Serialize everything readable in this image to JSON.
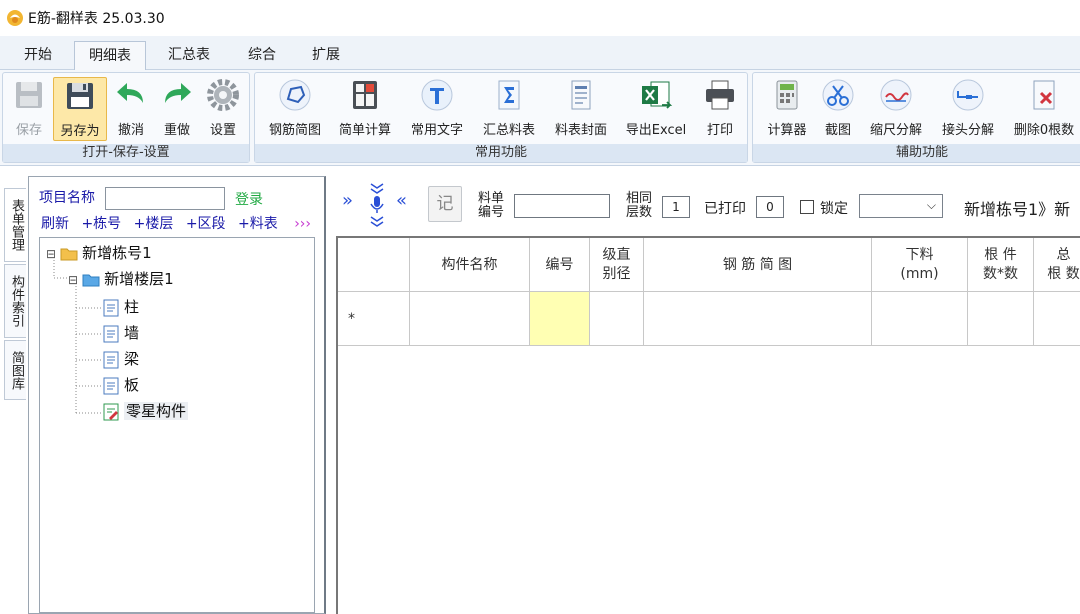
{
  "window": {
    "title": "E筋-翻样表 25.03.30"
  },
  "menu": {
    "tabs": [
      {
        "label": "开始"
      },
      {
        "label": "明细表"
      },
      {
        "label": "汇总表"
      },
      {
        "label": "综合"
      },
      {
        "label": "扩展"
      }
    ],
    "active_index": 1
  },
  "ribbon": {
    "groups": [
      {
        "label": "打开-保存-设置",
        "buttons": [
          {
            "label": "保存",
            "icon": "save-disk-icon",
            "enabled": false
          },
          {
            "label": "另存为",
            "icon": "save-as-disk-icon",
            "enabled": true,
            "pressed": true
          },
          {
            "label": "撤消",
            "icon": "undo-arrow-icon",
            "enabled": true
          },
          {
            "label": "重做",
            "icon": "redo-arrow-icon",
            "enabled": true
          },
          {
            "label": "设置",
            "icon": "gear-icon",
            "enabled": true
          }
        ]
      },
      {
        "label": "常用功能",
        "buttons": [
          {
            "label": "钢筋简图",
            "icon": "rebar-shape-icon"
          },
          {
            "label": "简单计算",
            "icon": "calculator-icon"
          },
          {
            "label": "常用文字",
            "icon": "text-t-icon"
          },
          {
            "label": "汇总料表",
            "icon": "sigma-sheet-icon"
          },
          {
            "label": "料表封面",
            "icon": "document-cover-icon"
          },
          {
            "label": "导出Excel",
            "icon": "excel-export-icon"
          },
          {
            "label": "打印",
            "icon": "printer-icon"
          }
        ]
      },
      {
        "label": "辅助功能",
        "buttons": [
          {
            "label": "计算器",
            "icon": "calculator-keypad-icon"
          },
          {
            "label": "截图",
            "icon": "scissors-icon"
          },
          {
            "label": "缩尺分解",
            "icon": "scale-wave-icon"
          },
          {
            "label": "接头分解",
            "icon": "joint-split-icon"
          },
          {
            "label": "删除0根数",
            "icon": "delete-doc-icon"
          }
        ]
      }
    ]
  },
  "side_tabs": [
    {
      "label": "表单管理"
    },
    {
      "label": "构件索引"
    },
    {
      "label": "简图库"
    }
  ],
  "left_panel": {
    "project_label": "项目名称",
    "project_value": "",
    "login_label": "登录",
    "actions": [
      "刷新",
      "+栋号",
      "+楼层",
      "+区段",
      "+料表"
    ],
    "more_label": "›››",
    "tree": [
      {
        "label": "新增栋号1",
        "level": 0,
        "icon": "folder-icon",
        "toggle": "⊟"
      },
      {
        "label": "新增楼层1",
        "level": 1,
        "icon": "folder-icon",
        "toggle": "⊟"
      },
      {
        "label": "柱",
        "level": 2,
        "icon": "sheet-icon"
      },
      {
        "label": "墙",
        "level": 2,
        "icon": "sheet-icon"
      },
      {
        "label": "梁",
        "level": 2,
        "icon": "sheet-icon"
      },
      {
        "label": "板",
        "level": 2,
        "icon": "sheet-icon"
      },
      {
        "label": "零星构件",
        "level": 2,
        "icon": "edit-sheet-icon",
        "selected": true
      }
    ]
  },
  "toolbar": {
    "nav_next": "»",
    "nav_prev": "«",
    "record_label": "记",
    "sheet_no_label_1": "料单",
    "sheet_no_label_2": "编号",
    "sheet_no_value": "",
    "same_floor_label_1": "相同",
    "same_floor_label_2": "层数",
    "same_floor_value": "1",
    "printed_label": "已打印",
    "printed_value": "0",
    "lock_label": "锁定",
    "lock_checked": false,
    "select_value": "",
    "breadcrumb": "新增栋号1》新"
  },
  "grid": {
    "headers": [
      {
        "label": ""
      },
      {
        "label": "构件名称"
      },
      {
        "label": "编号"
      },
      {
        "label": "级直\n别径"
      },
      {
        "label": "钢 筋 简 图"
      },
      {
        "label": "下料\n(mm)"
      },
      {
        "label": "根 件\n数*数"
      },
      {
        "label": "总\n根 数"
      }
    ],
    "row_marker": "*"
  }
}
